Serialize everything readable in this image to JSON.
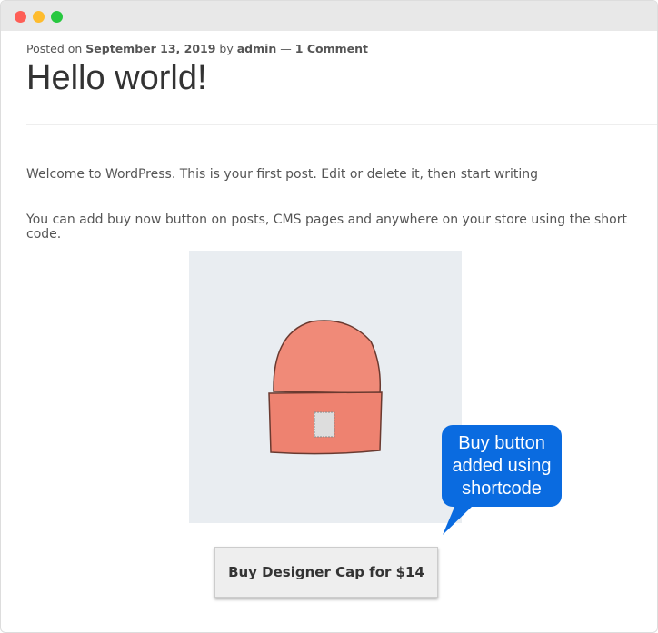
{
  "window": {
    "controls": {
      "close_color": "#fe5f57",
      "minimize_color": "#febc2e",
      "maximize_color": "#28c840"
    }
  },
  "post": {
    "meta_prefix": "Posted on ",
    "date": "September 13, 2019",
    "by": " by ",
    "author": "admin",
    "sep": " — ",
    "comments": "1 Comment",
    "title": "Hello world!",
    "paragraphs": [
      "Welcome to WordPress. This is your first post. Edit or delete it, then start writing",
      "You can add buy now button on posts, CMS pages and anywhere on your store using the short code."
    ],
    "buy_button": "Buy Designer Cap for $14"
  },
  "callout": {
    "text": "Buy button added using shortcode",
    "color": "#0a6be0"
  }
}
